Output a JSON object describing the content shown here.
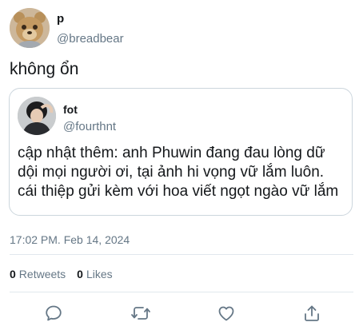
{
  "author": {
    "display_name": "p",
    "handle": "@breadbear",
    "avatar_icon": "bear-plush-avatar-icon"
  },
  "tweet": {
    "text": "không ổn",
    "timestamp": "17:02 PM. Feb 14, 2024"
  },
  "quoted": {
    "display_name": "fot",
    "handle": "@fourthnt",
    "avatar_icon": "person-avatar-icon",
    "text": "cập nhật thêm: anh Phuwin đang đau lòng dữ dội mọi người ơi, tại ảnh hi vọng vữ lắm luôn. cái thiệp gửi kèm với hoa viết ngọt ngào vữ lắm"
  },
  "stats": {
    "retweets_count": "0",
    "retweets_label": "Retweets",
    "likes_count": "0",
    "likes_label": "Likes"
  },
  "actions": {
    "reply_icon": "reply-icon",
    "retweet_icon": "retweet-icon",
    "like_icon": "heart-icon",
    "share_icon": "share-icon"
  },
  "colors": {
    "text_primary": "#14171a",
    "text_secondary": "#657786",
    "border": "#ccd6dd",
    "icon": "#657786"
  }
}
